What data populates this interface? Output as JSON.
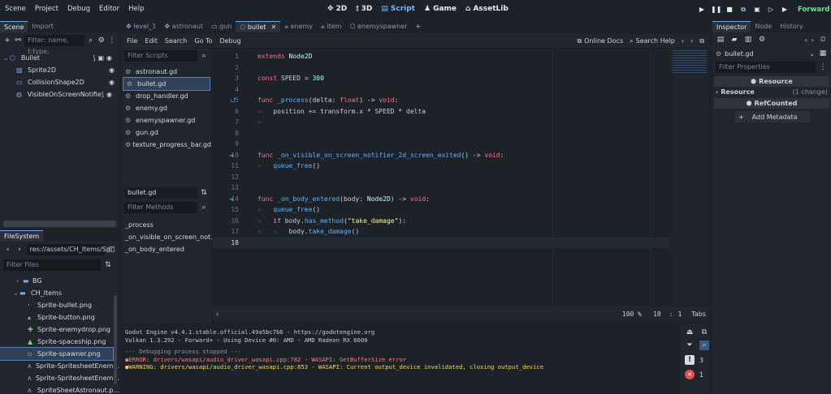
{
  "menu": [
    "Scene",
    "Project",
    "Debug",
    "Editor",
    "Help"
  ],
  "workspaces": [
    {
      "label": "2D",
      "icon": "2d-icon"
    },
    {
      "label": "3D",
      "icon": "3d-icon"
    },
    {
      "label": "Script",
      "icon": "script-icon"
    },
    {
      "label": "Game",
      "icon": "game-icon"
    },
    {
      "label": "AssetLib",
      "icon": "assetlib-icon"
    }
  ],
  "renderer": "Forward+",
  "scene_dock": {
    "tabs": [
      "Scene",
      "Import"
    ],
    "filter_placeholder": "Filter: name, t:type,",
    "nodes": [
      {
        "name": "Bullet",
        "icon": "node2d-icon"
      },
      {
        "name": "Sprite2D",
        "icon": "sprite-icon"
      },
      {
        "name": "CollisionShape2D",
        "icon": "collision-icon"
      },
      {
        "name": "VisibleOnScreenNotifie",
        "icon": "notifier-icon"
      }
    ]
  },
  "filesystem": {
    "tab": "FileSystem",
    "path": "res://assets/CH_Items/Spr",
    "filter_placeholder": "Filter Files",
    "items": [
      "BG",
      "CH_Items",
      "Sprite-bullet.png",
      "Sprite-button.png",
      "Sprite-enemydrop.png",
      "Sprite-spaceship.png",
      "Sprite-spawner.png",
      "Sprite-SpritesheetEnem...",
      "Sprite-SpritesheetEnem...",
      "SpriteSheetAstronaut.p..."
    ]
  },
  "script_tabs": [
    "level_1",
    "astronaut",
    "gun",
    "bullet",
    "enemy",
    "item",
    "enemyspawner"
  ],
  "script_menu": [
    "File",
    "Edit",
    "Search",
    "Go To",
    "Debug"
  ],
  "online_docs": "Online Docs",
  "search_help": "Search Help",
  "scripts_filter_placeholder": "Filter Scripts",
  "scripts": [
    "astronaut.gd",
    "bullet.gd",
    "drop_handler.gd",
    "enemy.gd",
    "enemyspawner.gd",
    "gun.gd",
    "texture_progress_bar.gd"
  ],
  "current_script": "bullet.gd",
  "methods_filter_placeholder": "Filter Methods",
  "methods": [
    "_process",
    "_on_visible_on_screen_not...",
    "_on_body_entered"
  ],
  "code_lines": [
    "1",
    "2",
    "3",
    "4",
    "5",
    "6",
    "7",
    "8",
    "9",
    "10",
    "11",
    "12",
    "13",
    "14",
    "15",
    "16",
    "17",
    "18"
  ],
  "status": {
    "zoom": "100 %",
    "line": "18",
    "col": "1",
    "indent": "Tabs"
  },
  "output": {
    "l1": "Godot Engine v4.4.1.stable.official.49a5bc7b6 - https://godotengine.org",
    "l2": "Vulkan 1.3.292 - Forward+ - Using Device #0: AMD - AMD Radeon RX 6600",
    "l3": "--- Debugging process stopped ---",
    "l4": "ERROR: drivers/wasapi/audio_driver_wasapi.cpp:782 - WASAPI: GetBufferSize error",
    "l5": "WARNING: drivers/wasapi/audio_driver_wasapi.cpp:853 - WASAPI: Current output_device invalidated, closing output_device",
    "warn_count": "3",
    "err_count": "1"
  },
  "inspector": {
    "tabs": [
      "Inspector",
      "Node",
      "History"
    ],
    "resource_name": "bullet.gd",
    "filter_placeholder": "Filter Properties",
    "section_resource": "Resource",
    "prop_resource": "Resource",
    "prop_resource_value": "(1 change)",
    "section_refcounted": "RefCounted",
    "add_metadata": "Add Metadata"
  }
}
